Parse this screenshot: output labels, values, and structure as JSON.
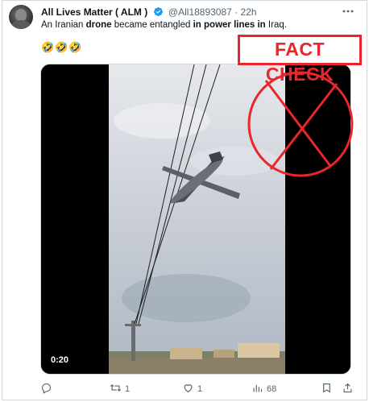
{
  "tweet": {
    "author_name": "All Lives Matter ( ALM )",
    "handle": "@All18893087",
    "separator": "·",
    "time": "22h",
    "text_parts": [
      "An Iranian ",
      "drone",
      " became entangled ",
      "in power lines in",
      " Iraq."
    ],
    "emojis": "🤣🤣🤣",
    "verified": true
  },
  "media": {
    "duration": "0:20"
  },
  "overlay": {
    "fact_check_label": "FACT CHECK",
    "color": "#e8262b"
  },
  "actions": {
    "reply_count": "",
    "retweet_count": "1",
    "like_count": "1",
    "views_count": "68"
  },
  "icons": [
    "more-icon",
    "verified-icon",
    "reply-icon",
    "retweet-icon",
    "like-icon",
    "views-icon",
    "bookmark-icon",
    "share-icon"
  ]
}
